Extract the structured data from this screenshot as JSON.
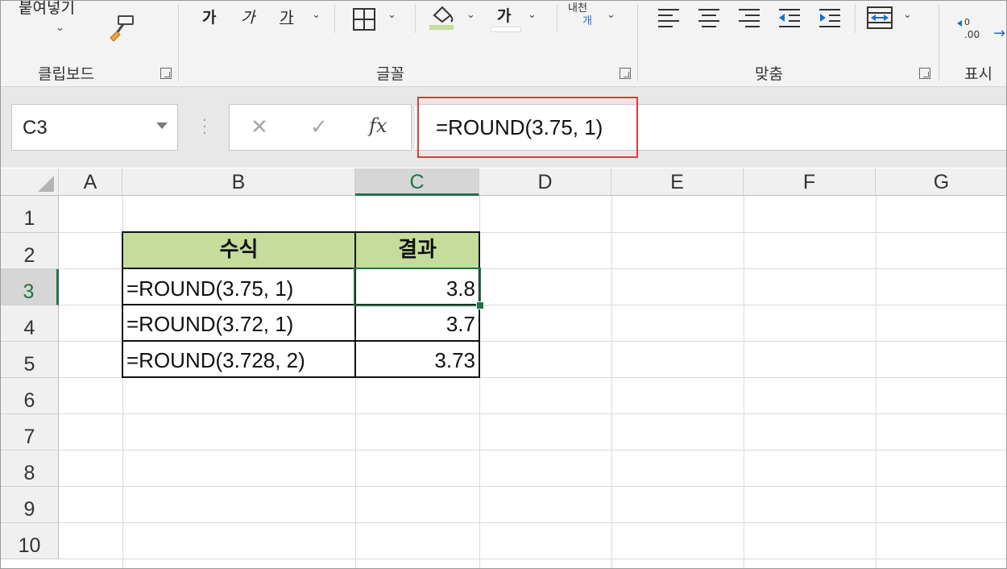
{
  "ribbon": {
    "clipboard": {
      "paste_label": "붙여넣기",
      "group_label": "클립보드"
    },
    "font": {
      "group_label": "글꼴",
      "bold_label": "가",
      "italic_label": "가",
      "underline_label": "가",
      "fontcolor_label": "가"
    },
    "alignment": {
      "wrap_label_top": "내천",
      "wrap_label_bottom": "개",
      "group_label": "맞춤"
    },
    "number": {
      "group_label": "표시"
    }
  },
  "formula_bar": {
    "name_box": "C3",
    "formula": "=ROUND(3.75, 1)",
    "cancel_label": "✕",
    "enter_label": "✓",
    "fx_label": "fx"
  },
  "columns": [
    "A",
    "B",
    "C",
    "D",
    "E",
    "F",
    "G"
  ],
  "rows": [
    "1",
    "2",
    "3",
    "4",
    "5",
    "6",
    "7",
    "8",
    "9",
    "10"
  ],
  "table": {
    "header": {
      "formula": "수식",
      "result": "결과"
    },
    "rows": [
      {
        "formula": "=ROUND(3.75, 1)",
        "result": "3.8"
      },
      {
        "formula": "=ROUND(3.72, 1)",
        "result": "3.7"
      },
      {
        "formula": "=ROUND(3.728, 2)",
        "result": "3.73"
      }
    ]
  },
  "colors": {
    "accent": "#217346",
    "header_fill": "#c5dc9b",
    "highlight_box": "#e03a3a"
  }
}
